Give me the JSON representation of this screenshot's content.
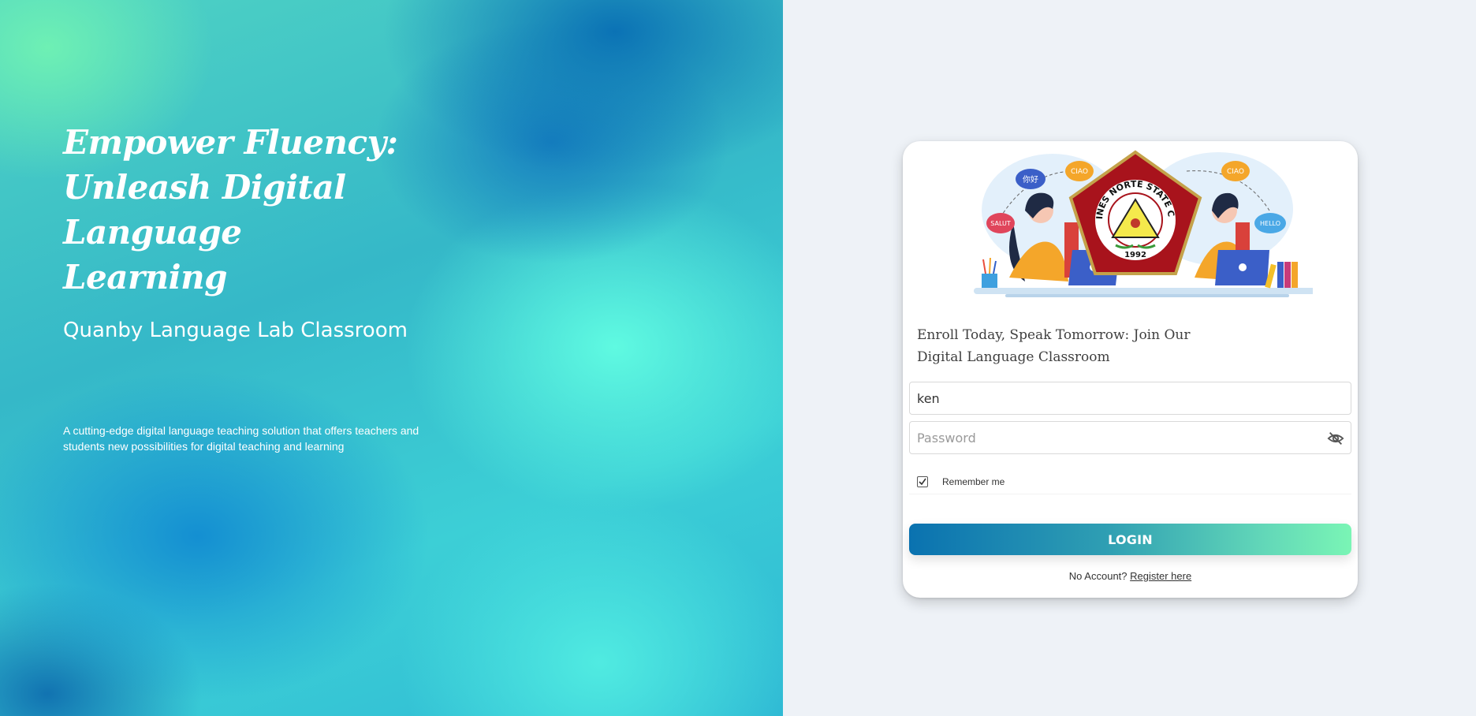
{
  "hero": {
    "title_line1": "Empower Fluency:",
    "title_line2": "Unleash Digital Language",
    "title_line3": "Learning",
    "subtitle": "Quanby Language Lab Classroom",
    "description": "A cutting-edge digital language teaching solution that offers teachers and students new possibilities for digital teaching and learning"
  },
  "card": {
    "logo": {
      "arc_text": "CAMARINES NORTE STATE COLLEGE",
      "year": "1992"
    },
    "bubbles": [
      "你好",
      "CIAO",
      "SALUT",
      "CIAO",
      "HELLO"
    ],
    "tagline_line1": "Enroll Today, Speak Tomorrow: Join Our",
    "tagline_line2": "Digital Language Classroom",
    "username_value": "ken",
    "password_placeholder": "Password",
    "remember_label": "Remember me",
    "remember_checked": true,
    "login_label": "LOGIN",
    "no_account_text": "No Account?",
    "register_link": "Register here"
  },
  "colors": {
    "accent_start": "#0a72b0",
    "accent_end": "#7af5b5",
    "page_bg": "#eef2f7"
  },
  "icons": {
    "password_toggle": "eye-off-icon",
    "remember_checkbox": "check-icon"
  }
}
